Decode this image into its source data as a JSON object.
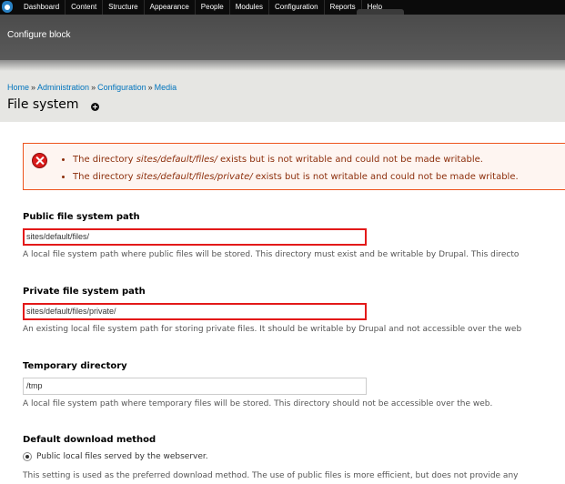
{
  "toolbar": {
    "home_icon": "drupal-drop-icon",
    "menu": [
      "Dashboard",
      "Content",
      "Structure",
      "Appearance",
      "People",
      "Modules",
      "Configuration",
      "Reports",
      "Help"
    ]
  },
  "overlay": {
    "title": "Configure block"
  },
  "breadcrumb": {
    "items": [
      "Home",
      "Administration",
      "Configuration",
      "Media"
    ],
    "separator": "»"
  },
  "page": {
    "title": "File system",
    "shortcut_icon": "add-shortcut-icon"
  },
  "messages": {
    "icon": "error-icon",
    "errors": [
      {
        "prefix": "The directory ",
        "path": "sites/default/files/",
        "suffix": " exists but is not writable and could not be made writable."
      },
      {
        "prefix": "The directory ",
        "path": "sites/default/files/private/",
        "suffix": " exists but is not writable and could not be made writable."
      }
    ]
  },
  "form": {
    "public_path": {
      "label": "Public file system path",
      "value": "sites/default/files/",
      "description": "A local file system path where public files will be stored. This directory must exist and be writable by Drupal. This directo"
    },
    "private_path": {
      "label": "Private file system path",
      "value": "sites/default/files/private/",
      "description": "An existing local file system path for storing private files. It should be writable by Drupal and not accessible over the web"
    },
    "temp_dir": {
      "label": "Temporary directory",
      "value": "/tmp",
      "description": "A local file system path where temporary files will be stored. This directory should not be accessible over the web."
    },
    "download_method": {
      "label": "Default download method",
      "option": "Public local files served by the webserver.",
      "selected": true,
      "description": "This setting is used as the preferred download method. The use of public files is more efficient, but does not provide any"
    }
  },
  "colors": {
    "toolbar_bg": "#0b0b0b",
    "link": "#0074bd",
    "error_border": "#ed541d",
    "error_bg": "#fef5f1",
    "error_text": "#8c2e0b",
    "field_error_border": "#e31919"
  }
}
